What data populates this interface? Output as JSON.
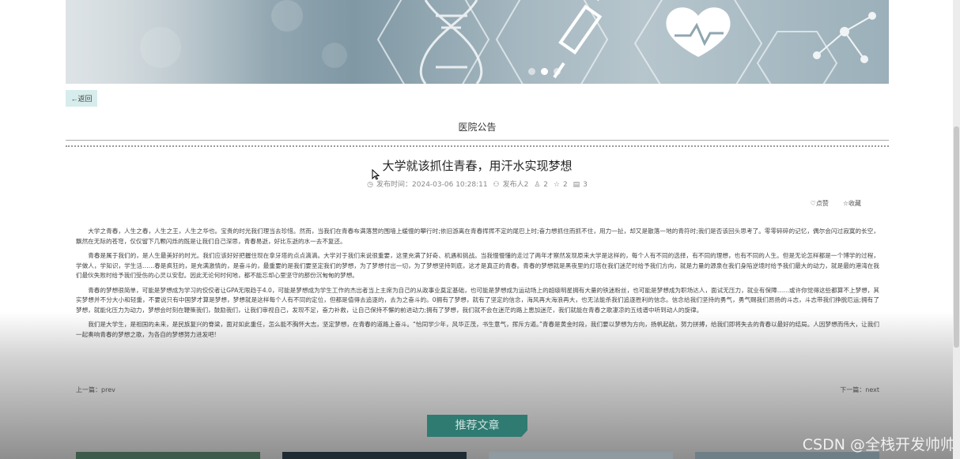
{
  "banner": {
    "active_dot": 1,
    "dot_count": 3
  },
  "back_button": {
    "label": "←返回"
  },
  "section": {
    "title": "医院公告"
  },
  "article": {
    "title": "大学就该抓住青春，用汗水实现梦想",
    "meta": {
      "publish_time": "发布时间：2024-03-06 10:28:11",
      "publisher": "发布人2",
      "likes": "2",
      "favorites": "2",
      "views": "3"
    },
    "actions": {
      "like_label": "♡点赞",
      "favorite_label": "☆收藏"
    },
    "paragraphs": [
      "大学之青春，人生之春，人生之王，人生之华也。宝贵的时光我们理当去珍惜。然而，当我们在青春布满落营的围墙上缓慢的攀行时;依旧游离在青春挥挥不定的尾巴上时;奋力想抓住而抓不住，用力一扯，却又是散落一地的青符时;我们是否该回头思考了。零零碎碎的记忆，偶尔会闪过寂寞的长空，飘然在无际的苍穹，仅仅留下几颗闪烁的既是让我们自己深思，青春易逝，好比东逝的水一去不复还。",
      "青春是属于我们的，是人生最美好的时光。我们应该好好把握住现在拿牙塔的点点滴滴。大学对于我们来说很重要，这里充满了好奇、机遇和挑战。当我慢慢懂的走过了两年才察然发现原来大学是这样的，每个人有不同的选择，有不同的理想，也有不同的人生。但是无论怎样都是一个博学的过程，学做人，学知识，学生活……春是疯狂的，是充满激情的，是奋斗的，最重要的是我们要坚定我们的梦想，为了梦想付出一切，为了梦想坚持到底，这才是真正的青春。青春的梦想就是黑夜里的灯塔在我们迷茫时给予我们方向，就是力量的源泉在我们身陷逆境时给予我们最大的动力，就是最的港湾在我们最伙失败时给予我们受伤的心灵以安慰。因此无论何时何地，都不能忘却心里坚守的那份沉甸甸的梦想。",
      "青春的梦想很简单，可能是梦想成为学习的佼佼者让GPA无限趋于4.0，可能是梦想成为学生工作的杰出者当上主席为自己的从政事业奠定基础，也可能是梦想成为运动场上的超级明星拥有大量的铁迷粉丝，也可能是梦想成为职场达人，面试无压力，就业有保障……或许你觉得这些都算不上梦想，其实梦想并不分大小和轻重，不要说只有中国梦才算是梦想，梦想就是这样每个人有不同的定位，但都是值得去追逐的，去为之奋斗的。0拥有了梦想，就有了坚定的信念，海风再大海浪再大，也无法能杀我们追逐胜利的信念。信念给我们坚持的勇气，勇气赐我们昂扬的斗志，斗志带我们挣脱厄运;拥有了梦想，就能化压力为动力，梦想会时刻在鞭策我们，鼓励我们，让我们审视自己，发现不足，奋力补救，让自己保持不懈的前进动力;拥有了梦想，我们就不会在迷茫的路上患加迷茫，我们就能在青春之歌凄凉的五线谱中听到动人的旋律。",
      "我们是大学生，是祖国的未来，是民族复兴的脊梁，面对如此重任，怎么能不胸怀大志，坚定梦想，在青春的道路上奋斗。“恰同学少年，风华正茂，书生意气，挥斥方遒。”青春是黄金时段，我们要以梦想为方向，扬帆起航，努力拼搏，给我们即将失去的青春以最好的结局。人因梦想而伟大，让我们一起奏响青春的梦想之歌，为各自的梦想努力进发吧!"
    ],
    "prev": "上一篇：prev",
    "next": "下一篇：next"
  },
  "recommend": {
    "title": "推荐文章"
  },
  "watermark": "CSDN @全栈开发帅帅",
  "colors": {
    "accent": "#2f7b72",
    "back_button_bg": "#d7ecec"
  }
}
